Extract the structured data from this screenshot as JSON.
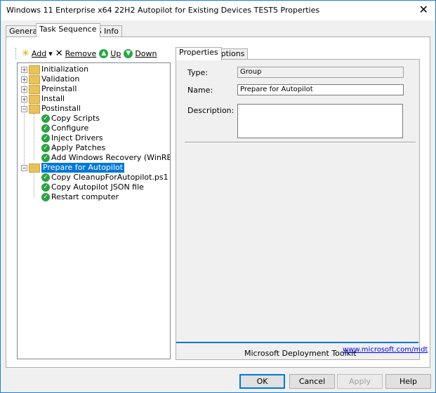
{
  "window": {
    "title": "Windows 11 Enterprise x64 22H2 Autopilot for Existing Devices TEST5 Properties",
    "close_glyph": "✕"
  },
  "tabs": [
    {
      "label": "General"
    },
    {
      "label": "Task Sequence"
    },
    {
      "label": "OS Info"
    }
  ],
  "toolbar": {
    "add_label": "Add",
    "add_dropdown": "▾",
    "remove_label": "Remove",
    "up_label": "Up",
    "down_label": "Down",
    "up_arrow": "▲",
    "down_arrow": "▼",
    "add_icon": "✳",
    "remove_icon": "✕"
  },
  "tree": {
    "items": [
      {
        "label": "Initialization"
      },
      {
        "label": "Validation"
      },
      {
        "label": "Preinstall"
      },
      {
        "label": "Install"
      },
      {
        "label": "Postinstall"
      },
      {
        "label": "Copy Scripts"
      },
      {
        "label": "Configure"
      },
      {
        "label": "Inject Drivers"
      },
      {
        "label": "Apply Patches"
      },
      {
        "label": "Add Windows Recovery (WinRE)"
      },
      {
        "label": "Prepare for Autopilot"
      },
      {
        "label": "Copy CleanupForAutopilot.ps1"
      },
      {
        "label": "Copy Autopilot JSON file"
      },
      {
        "label": "Restart computer"
      }
    ],
    "plus_glyph": "+",
    "minus_glyph": "−",
    "check_glyph": "✓"
  },
  "right_tabs": [
    {
      "label": "Properties"
    },
    {
      "label": "Options"
    }
  ],
  "properties": {
    "type_label": "Type:",
    "type_value": "Group",
    "name_label": "Name:",
    "name_value": "Prepare for Autopilot",
    "description_label": "Description:",
    "description_value": ""
  },
  "footer": {
    "mdt_text": "Microsoft Deployment Toolkit",
    "mdt_link": "www.microsoft.com/mdt"
  },
  "buttons": {
    "ok": "OK",
    "cancel": "Cancel",
    "apply": "Apply",
    "help": "Help"
  },
  "colors": {
    "accent": "#0078d7",
    "selection": "#0078d7",
    "check_green": "#2ea043",
    "folder": "#e8c25b"
  }
}
